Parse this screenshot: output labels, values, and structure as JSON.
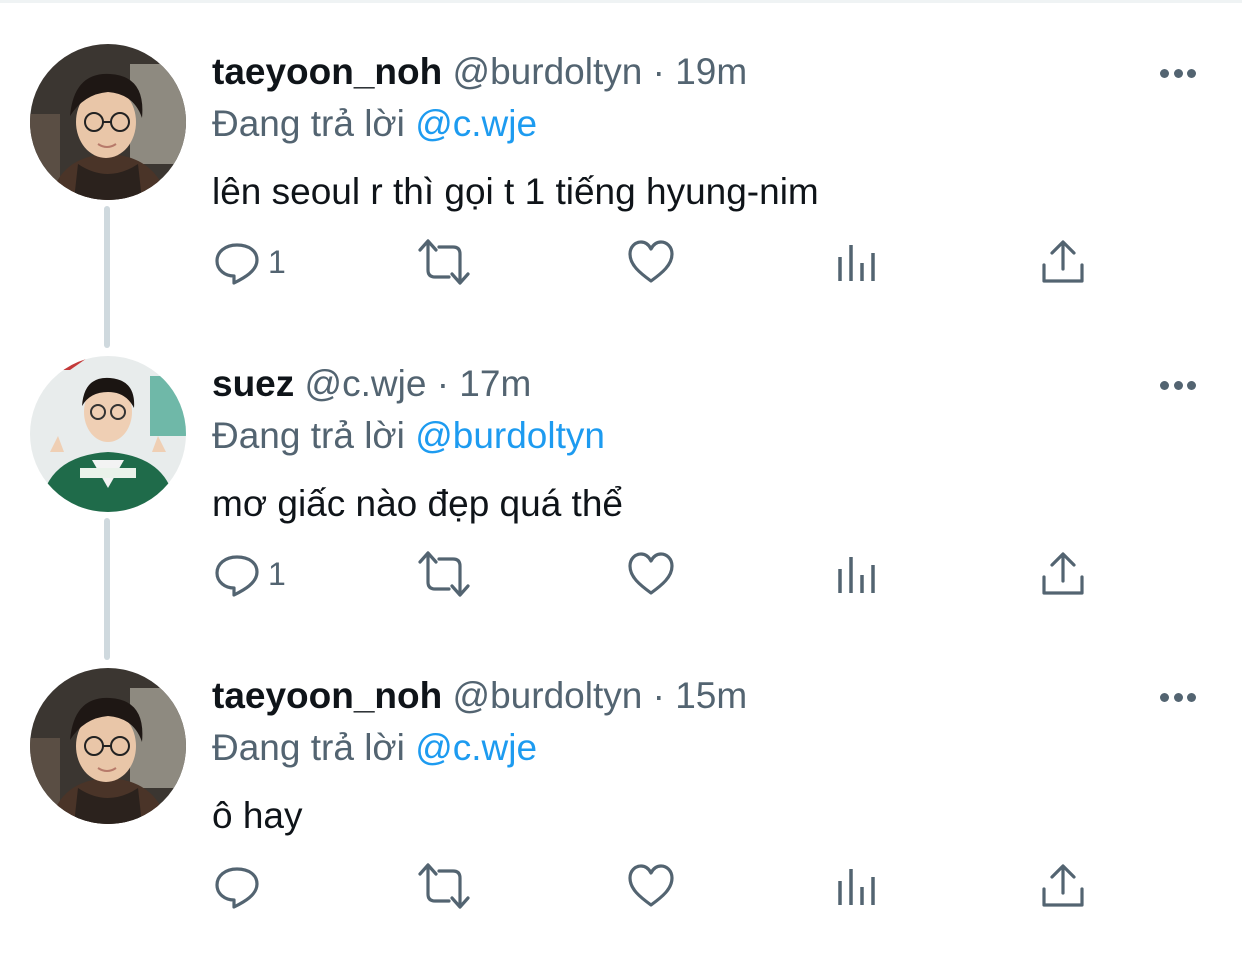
{
  "tweets": [
    {
      "name": "taeyoon_noh",
      "handle": "@burdoltyn",
      "separator": "·",
      "time": "19m",
      "reply_prefix": "Đang trả lời",
      "reply_to": "@c.wje",
      "text": "lên seoul r thì gọi t 1 tiếng hyung-nim",
      "reply_count": "1",
      "avatar": "avatar-taeyoon"
    },
    {
      "name": "suez",
      "handle": "@c.wje",
      "separator": "·",
      "time": "17m",
      "reply_prefix": "Đang trả lời",
      "reply_to": "@burdoltyn",
      "text": "mơ giấc nào đẹp quá thể",
      "reply_count": "1",
      "avatar": "avatar-suez"
    },
    {
      "name": "taeyoon_noh",
      "handle": "@burdoltyn",
      "separator": "·",
      "time": "15m",
      "reply_prefix": "Đang trả lời",
      "reply_to": "@c.wje",
      "text": "ô hay",
      "reply_count": "",
      "avatar": "avatar-taeyoon"
    }
  ],
  "icons": {
    "reply": "reply-icon",
    "retweet": "retweet-icon",
    "like": "heart-icon",
    "views": "analytics-icon",
    "share": "share-icon",
    "more": "more-icon"
  },
  "colors": {
    "text_primary": "#0f1419",
    "text_secondary": "#536471",
    "link": "#1d9bf0",
    "thread_line": "#cfd9de"
  }
}
